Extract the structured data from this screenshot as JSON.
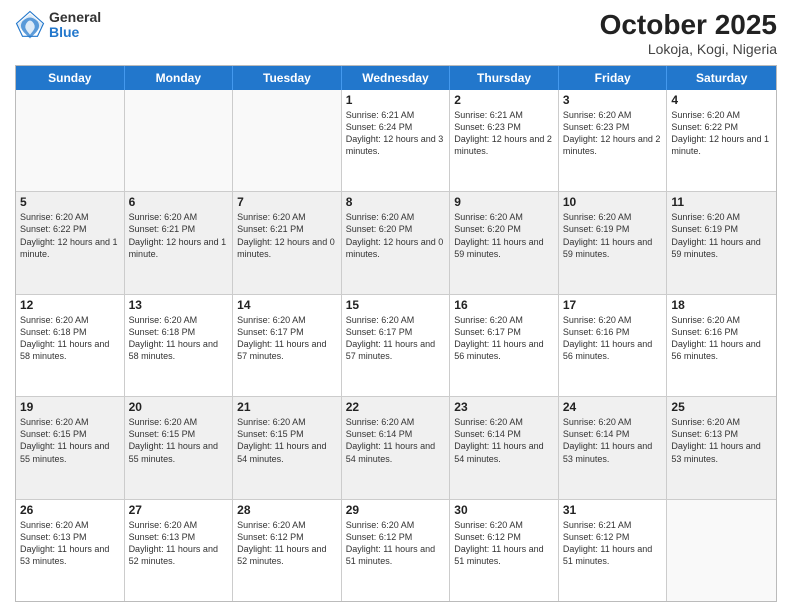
{
  "header": {
    "logo": {
      "general": "General",
      "blue": "Blue"
    },
    "title": "October 2025",
    "subtitle": "Lokoja, Kogi, Nigeria"
  },
  "calendar": {
    "days": [
      "Sunday",
      "Monday",
      "Tuesday",
      "Wednesday",
      "Thursday",
      "Friday",
      "Saturday"
    ],
    "rows": [
      [
        {
          "day": "",
          "info": "",
          "empty": true
        },
        {
          "day": "",
          "info": "",
          "empty": true
        },
        {
          "day": "",
          "info": "",
          "empty": true
        },
        {
          "day": "1",
          "info": "Sunrise: 6:21 AM\nSunset: 6:24 PM\nDaylight: 12 hours and 3 minutes."
        },
        {
          "day": "2",
          "info": "Sunrise: 6:21 AM\nSunset: 6:23 PM\nDaylight: 12 hours and 2 minutes."
        },
        {
          "day": "3",
          "info": "Sunrise: 6:20 AM\nSunset: 6:23 PM\nDaylight: 12 hours and 2 minutes."
        },
        {
          "day": "4",
          "info": "Sunrise: 6:20 AM\nSunset: 6:22 PM\nDaylight: 12 hours and 1 minute."
        }
      ],
      [
        {
          "day": "5",
          "info": "Sunrise: 6:20 AM\nSunset: 6:22 PM\nDaylight: 12 hours and 1 minute."
        },
        {
          "day": "6",
          "info": "Sunrise: 6:20 AM\nSunset: 6:21 PM\nDaylight: 12 hours and 1 minute."
        },
        {
          "day": "7",
          "info": "Sunrise: 6:20 AM\nSunset: 6:21 PM\nDaylight: 12 hours and 0 minutes."
        },
        {
          "day": "8",
          "info": "Sunrise: 6:20 AM\nSunset: 6:20 PM\nDaylight: 12 hours and 0 minutes."
        },
        {
          "day": "9",
          "info": "Sunrise: 6:20 AM\nSunset: 6:20 PM\nDaylight: 11 hours and 59 minutes."
        },
        {
          "day": "10",
          "info": "Sunrise: 6:20 AM\nSunset: 6:19 PM\nDaylight: 11 hours and 59 minutes."
        },
        {
          "day": "11",
          "info": "Sunrise: 6:20 AM\nSunset: 6:19 PM\nDaylight: 11 hours and 59 minutes."
        }
      ],
      [
        {
          "day": "12",
          "info": "Sunrise: 6:20 AM\nSunset: 6:18 PM\nDaylight: 11 hours and 58 minutes."
        },
        {
          "day": "13",
          "info": "Sunrise: 6:20 AM\nSunset: 6:18 PM\nDaylight: 11 hours and 58 minutes."
        },
        {
          "day": "14",
          "info": "Sunrise: 6:20 AM\nSunset: 6:17 PM\nDaylight: 11 hours and 57 minutes."
        },
        {
          "day": "15",
          "info": "Sunrise: 6:20 AM\nSunset: 6:17 PM\nDaylight: 11 hours and 57 minutes."
        },
        {
          "day": "16",
          "info": "Sunrise: 6:20 AM\nSunset: 6:17 PM\nDaylight: 11 hours and 56 minutes."
        },
        {
          "day": "17",
          "info": "Sunrise: 6:20 AM\nSunset: 6:16 PM\nDaylight: 11 hours and 56 minutes."
        },
        {
          "day": "18",
          "info": "Sunrise: 6:20 AM\nSunset: 6:16 PM\nDaylight: 11 hours and 56 minutes."
        }
      ],
      [
        {
          "day": "19",
          "info": "Sunrise: 6:20 AM\nSunset: 6:15 PM\nDaylight: 11 hours and 55 minutes."
        },
        {
          "day": "20",
          "info": "Sunrise: 6:20 AM\nSunset: 6:15 PM\nDaylight: 11 hours and 55 minutes."
        },
        {
          "day": "21",
          "info": "Sunrise: 6:20 AM\nSunset: 6:15 PM\nDaylight: 11 hours and 54 minutes."
        },
        {
          "day": "22",
          "info": "Sunrise: 6:20 AM\nSunset: 6:14 PM\nDaylight: 11 hours and 54 minutes."
        },
        {
          "day": "23",
          "info": "Sunrise: 6:20 AM\nSunset: 6:14 PM\nDaylight: 11 hours and 54 minutes."
        },
        {
          "day": "24",
          "info": "Sunrise: 6:20 AM\nSunset: 6:14 PM\nDaylight: 11 hours and 53 minutes."
        },
        {
          "day": "25",
          "info": "Sunrise: 6:20 AM\nSunset: 6:13 PM\nDaylight: 11 hours and 53 minutes."
        }
      ],
      [
        {
          "day": "26",
          "info": "Sunrise: 6:20 AM\nSunset: 6:13 PM\nDaylight: 11 hours and 53 minutes."
        },
        {
          "day": "27",
          "info": "Sunrise: 6:20 AM\nSunset: 6:13 PM\nDaylight: 11 hours and 52 minutes."
        },
        {
          "day": "28",
          "info": "Sunrise: 6:20 AM\nSunset: 6:12 PM\nDaylight: 11 hours and 52 minutes."
        },
        {
          "day": "29",
          "info": "Sunrise: 6:20 AM\nSunset: 6:12 PM\nDaylight: 11 hours and 51 minutes."
        },
        {
          "day": "30",
          "info": "Sunrise: 6:20 AM\nSunset: 6:12 PM\nDaylight: 11 hours and 51 minutes."
        },
        {
          "day": "31",
          "info": "Sunrise: 6:21 AM\nSunset: 6:12 PM\nDaylight: 11 hours and 51 minutes."
        },
        {
          "day": "",
          "info": "",
          "empty": true
        }
      ]
    ]
  }
}
